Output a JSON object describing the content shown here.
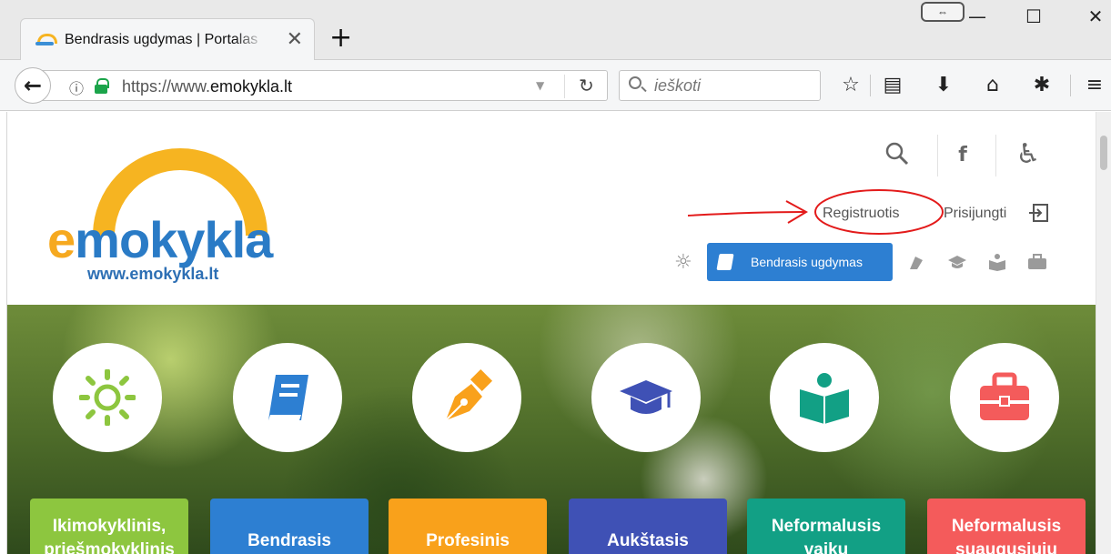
{
  "browser": {
    "tab_title": "Bendrasis ugdymas | Portalas",
    "tab_close": "✕",
    "new_tab": "+",
    "url_prefix": "https://www.",
    "url_domain": "emokykla.lt",
    "search_placeholder": "ieškoti",
    "window_controls": {
      "minimize": "—",
      "maximize": "☐",
      "close": "✕"
    }
  },
  "site": {
    "logo_prefix": "e",
    "logo_rest": "mokykla",
    "logo_url": "www.emokykla.lt",
    "header": {
      "register": "Registruotis",
      "login": "Prisijungti",
      "facebook": "f"
    },
    "active_category": "Bendrasis ugdymas",
    "categories": [
      {
        "label": "Ikimokyklinis, priešmokyklinis",
        "color": "#8dc63f",
        "icon": "sun-icon"
      },
      {
        "label": "Bendrasis",
        "color": "#2d7fd2",
        "icon": "book-icon"
      },
      {
        "label": "Profesinis",
        "color": "#f9a11b",
        "icon": "pen-nib-icon"
      },
      {
        "label": "Aukštasis",
        "color": "#3f51b5",
        "icon": "graduation-cap-icon"
      },
      {
        "label": "Neformalusis vaikų",
        "color": "#12a085",
        "icon": "reader-icon"
      },
      {
        "label": "Neformalusis suaugusiųjų",
        "color": "#f45b5b",
        "icon": "briefcase-icon"
      }
    ]
  }
}
